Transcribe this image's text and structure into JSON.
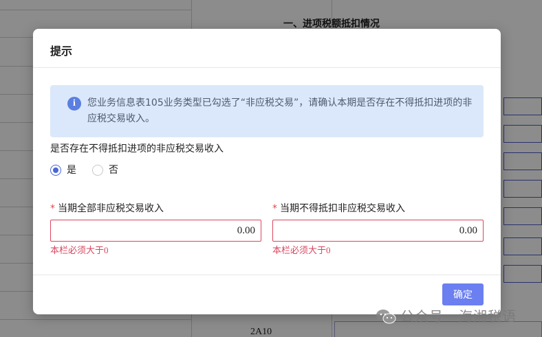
{
  "background": {
    "section_title": "一、进项税额抵扣情况",
    "row_code": "2A10"
  },
  "dialog": {
    "title": "提示",
    "alert": {
      "icon": "info-icon",
      "message": "您业务信息表105业务类型已勾选了“非应税交易”，请确认本期是否存在不得抵扣进项的非应税交易收入。"
    },
    "question": "是否存在不得抵扣进项的非应税交易收入",
    "options": [
      {
        "label": "是",
        "checked": true
      },
      {
        "label": "否",
        "checked": false
      }
    ],
    "fields": [
      {
        "required_mark": "*",
        "label": "当期全部非应税交易收入",
        "value": "0.00",
        "error": "本栏必须大于0"
      },
      {
        "required_mark": "*",
        "label": "当期不得抵扣非应税交易收入",
        "value": "0.00",
        "error": "本栏必须大于0"
      }
    ],
    "confirm_label": "确定"
  },
  "watermark": {
    "text": "公众号 · 海湘税语",
    "icon": "wechat-icon"
  },
  "colors": {
    "accent": "#6b7ff0",
    "error": "#d9455e",
    "alert_bg": "#dbe8fb",
    "radio_checked": "#4a66d8"
  }
}
